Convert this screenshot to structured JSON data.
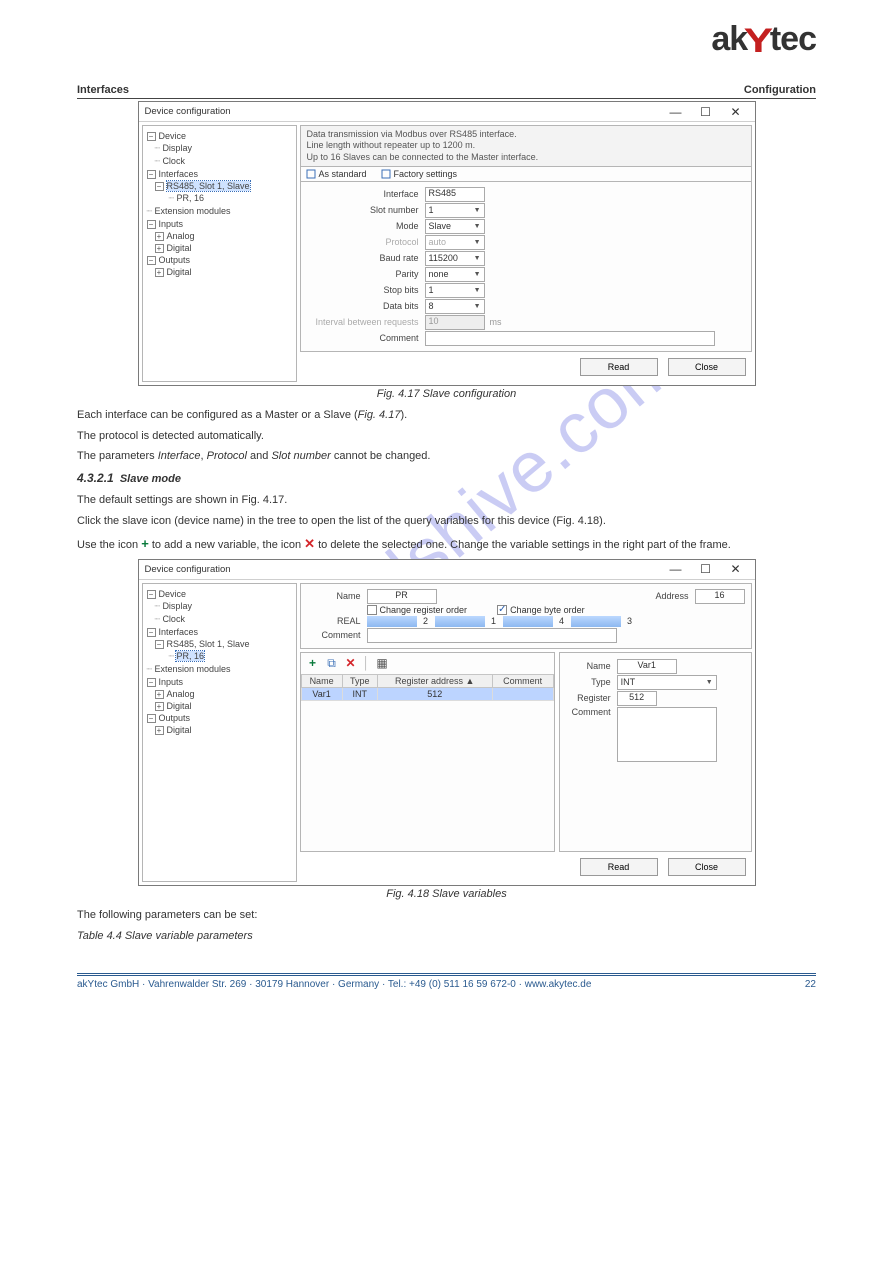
{
  "logo": {
    "ak": "ak",
    "y": "Y",
    "tec": "tec"
  },
  "header": {
    "left": "Interfaces",
    "right": "Configuration"
  },
  "watermark": "manualshive.com",
  "fig1": {
    "title": "Device configuration",
    "minimize": "—",
    "maximize": "☐",
    "close": "✕",
    "tree": {
      "device": "Device",
      "display": "Display",
      "clock": "Clock",
      "interfaces": "Interfaces",
      "rs485": "RS485, Slot 1, Slave",
      "pr16": "PR, 16",
      "ext": "Extension modules",
      "inputs": "Inputs",
      "analog": "Analog",
      "digital": "Digital",
      "outputs": "Outputs",
      "digital2": "Digital"
    },
    "info_l1": "Data transmission via Modbus over RS485 interface.",
    "info_l2": "Line length without repeater up to 1200 m.",
    "info_l3": "Up to 16 Slaves can be connected to the Master interface.",
    "toolbar": {
      "std": "As standard",
      "factory": "Factory settings"
    },
    "form": {
      "iface_l": "Interface",
      "iface_v": "RS485",
      "slot_l": "Slot number",
      "slot_v": "1",
      "mode_l": "Mode",
      "mode_v": "Slave",
      "proto_l": "Protocol",
      "proto_v": "auto",
      "baud_l": "Baud rate",
      "baud_v": "115200",
      "parity_l": "Parity",
      "parity_v": "none",
      "stop_l": "Stop bits",
      "stop_v": "1",
      "data_l": "Data bits",
      "data_v": "8",
      "intv_l": "Interval between requests",
      "intv_v": "10",
      "intv_u": "ms",
      "comment_l": "Comment",
      "comment_v": ""
    },
    "buttons": {
      "read": "Read",
      "close": "Close"
    }
  },
  "caption1": "Fig. 4.17 Slave configuration",
  "para1_a": "Each interface can be configured as a Master or a Slave (",
  "para1_b": ").",
  "para2": "The protocol is detected automatically.",
  "para3_a": "The parameters ",
  "para3_b": "Interface",
  "para3_c": ", ",
  "para3_d": "Protocol",
  "para3_e": " and ",
  "para3_f": "Slot number",
  "para3_g": " cannot be changed.",
  "sect_num": "4.3.2.1",
  "sect_title": "Slave mode",
  "slave_p1": "The default settings are shown in Fig. 4.17.",
  "slave_p2": "Click the slave icon (device name) in the tree to open the list of the query variables for this device (Fig. 4.18).",
  "slave_p3_a": "Use the icon ",
  "slave_p3_b": " to add a new variable, the icon ",
  "slave_p3_c": " to delete the selected one. Change the variable settings in the right part of the frame.",
  "fig2": {
    "title": "Device configuration",
    "minimize": "—",
    "maximize": "☐",
    "close": "✕",
    "tree": {
      "device": "Device",
      "display": "Display",
      "clock": "Clock",
      "interfaces": "Interfaces",
      "rs485": "RS485, Slot 1, Slave",
      "pr16": "PR, 16",
      "ext": "Extension modules",
      "inputs": "Inputs",
      "analog": "Analog",
      "digital": "Digital",
      "outputs": "Outputs",
      "digital2": "Digital"
    },
    "upper": {
      "name_l": "Name",
      "name_v": "PR",
      "addr_l": "Address",
      "addr_v": "16",
      "chg_reg": "Change register order",
      "chg_byte": "Change byte order",
      "real_l": "REAL",
      "r2": "2",
      "r1": "1",
      "r4": "4",
      "r3": "3",
      "comment_l": "Comment",
      "comment_v": ""
    },
    "table": {
      "h_name": "Name",
      "h_type": "Type",
      "h_reg": "Register address ▲",
      "h_comment": "Comment",
      "row1": {
        "name": "Var1",
        "type": "INT",
        "reg": "512",
        "comment": ""
      }
    },
    "detail": {
      "name_l": "Name",
      "name_v": "Var1",
      "type_l": "Type",
      "type_v": "INT",
      "reg_l": "Register",
      "reg_v": "512",
      "comment_l": "Comment",
      "comment_v": ""
    },
    "buttons": {
      "read": "Read",
      "close": "Close"
    }
  },
  "caption2": "Fig. 4.18 Slave variables",
  "para_after": "The following parameters can be set:",
  "tbl_label": "Table 4.4 Slave variable parameters",
  "footer": {
    "left": "akYtec GmbH · Vahrenwalder Str. 269 · 30179 Hannover · Germany · Tel.: +49 (0) 511 16 59 672-0 · www.akytec.de",
    "right": "22"
  }
}
